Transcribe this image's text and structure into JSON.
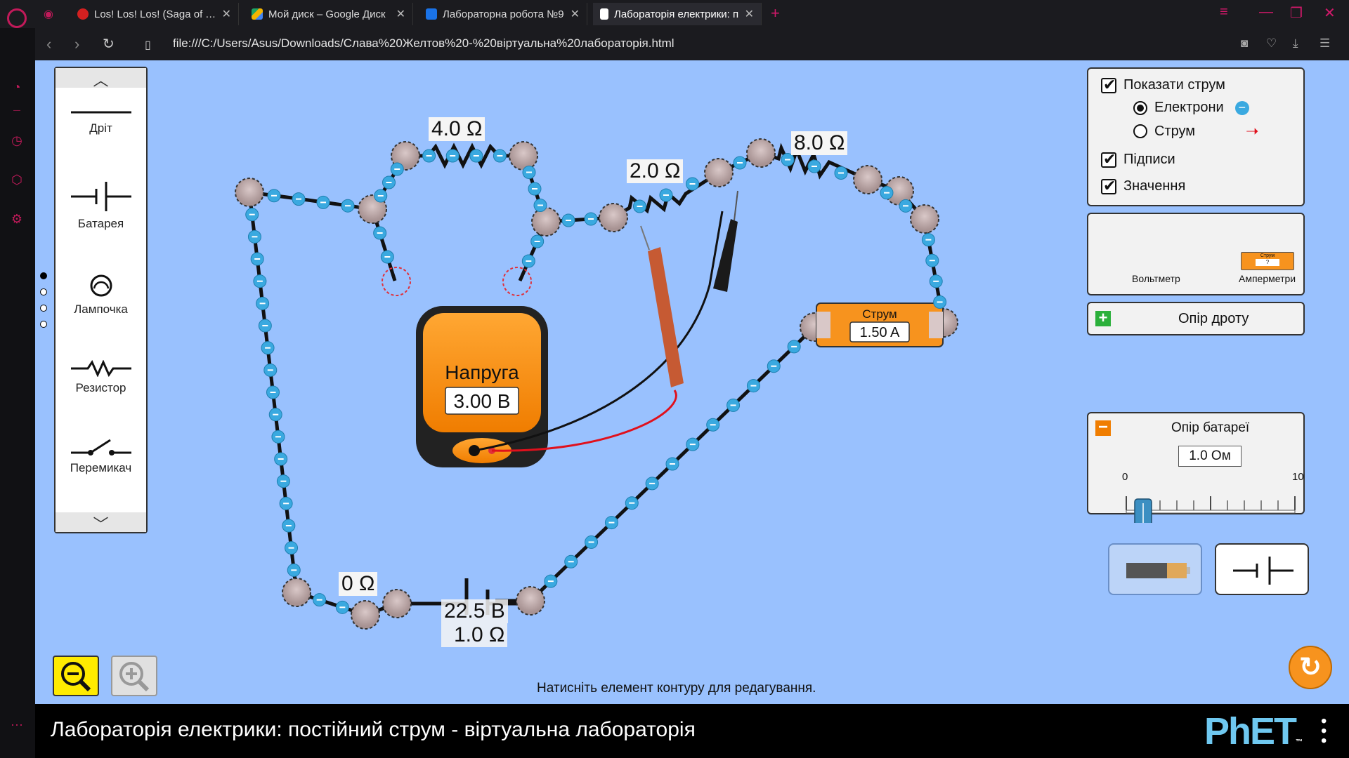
{
  "browser": {
    "tabs": [
      {
        "label": "Los! Los! Los! (Saga of Tany",
        "favicon_color": "#d42020"
      },
      {
        "label": "Мой диск – Google Диск",
        "favicon_color": "#f4b400"
      },
      {
        "label": "Лабораторна робота №9",
        "favicon_color": "#1a73e8"
      },
      {
        "label": "Лабораторія електрики: п",
        "favicon_color": "#ffffff",
        "active": true
      }
    ],
    "url": "file:///C:/Users/Asus/Downloads/Слава%20Желтов%20-%20віртуальна%20лабораторія.html"
  },
  "toolbox": {
    "items": [
      {
        "label": "Дріт",
        "icon": "wire-icon"
      },
      {
        "label": "Батарея",
        "icon": "battery-symbol-icon"
      },
      {
        "label": "Лампочка",
        "icon": "bulb-symbol-icon"
      },
      {
        "label": "Резистор",
        "icon": "resistor-symbol-icon"
      },
      {
        "label": "Перемикач",
        "icon": "switch-symbol-icon"
      }
    ]
  },
  "circuit": {
    "labels": {
      "r1": "4.0 Ω",
      "r2": "2.0 Ω",
      "r3": "8.0 Ω",
      "wire": "0 Ω",
      "battery_voltage": "22.5 В",
      "battery_resistance": "1.0 Ω"
    }
  },
  "voltmeter": {
    "title": "Напруга",
    "value": "3.00 В"
  },
  "ammeter": {
    "title": "Струм",
    "value": "1.50 A"
  },
  "controls": {
    "show_current": "Показати струм",
    "electrons": "Електрони",
    "current": "Струм",
    "labels": "Підписи",
    "values": "Значення",
    "voltmeter": "Вольтметр",
    "ammeter": "Амперметри",
    "ammeter_icon_label": "Струм",
    "ammeter_icon_value": "?",
    "wire_resistance": "Опір дроту",
    "battery_resistance_title": "Опір батареї",
    "battery_resistance_value": "1.0 Ом",
    "slider_min": "0",
    "slider_max": "10",
    "slider_value": 1.0
  },
  "hint": "Натисніть елемент контуру для редагування.",
  "footer": {
    "title": "Лабораторія електрики: постійний струм - віртуальна лабораторія",
    "logo": "PhET",
    "logo_tm": "™"
  },
  "colors": {
    "sim_bg": "#99c1fe",
    "voltmeter": "#f7931e",
    "electron": "#3aa9e0",
    "accent": "#c21a5a"
  }
}
